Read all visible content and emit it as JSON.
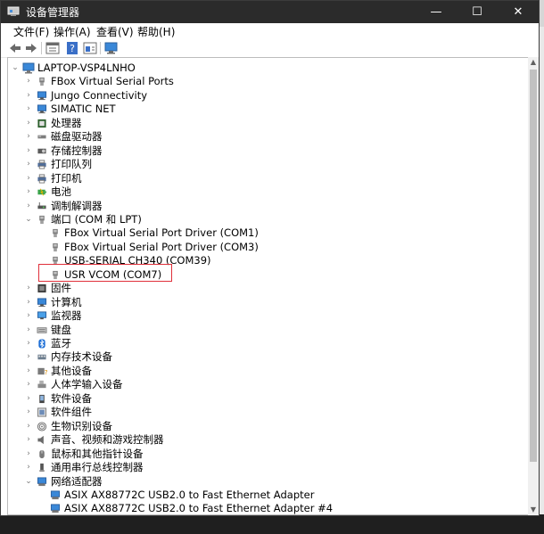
{
  "window": {
    "title": "设备管理器"
  },
  "window_controls": {
    "minimize": "—",
    "maximize": "☐",
    "close": "✕"
  },
  "menu": [
    "文件(F)",
    "操作(A)",
    "查看(V)",
    "帮助(H)"
  ],
  "toolbar": [
    "back-icon",
    "forward-icon",
    "properties-grid-icon",
    "help-icon",
    "view-icon",
    "monitor-scan-icon"
  ],
  "tree": {
    "root": {
      "label": "LAPTOP-VSP4LNHO",
      "expanded": true
    },
    "items": [
      {
        "label": "FBox Virtual Serial Ports",
        "level": 1,
        "icon": "port-icon",
        "expanded": false
      },
      {
        "label": "Jungo Connectivity",
        "level": 1,
        "icon": "network-device-icon",
        "expanded": false
      },
      {
        "label": "SIMATIC NET",
        "level": 1,
        "icon": "network-device-icon",
        "expanded": false
      },
      {
        "label": "处理器",
        "level": 1,
        "icon": "processor-icon",
        "expanded": false
      },
      {
        "label": "磁盘驱动器",
        "level": 1,
        "icon": "disk-drive-icon",
        "expanded": false
      },
      {
        "label": "存储控制器",
        "level": 1,
        "icon": "storage-controller-icon",
        "expanded": false
      },
      {
        "label": "打印队列",
        "level": 1,
        "icon": "printer-icon",
        "expanded": false
      },
      {
        "label": "打印机",
        "level": 1,
        "icon": "printer-icon",
        "expanded": false
      },
      {
        "label": "电池",
        "level": 1,
        "icon": "battery-icon",
        "expanded": false
      },
      {
        "label": "调制解调器",
        "level": 1,
        "icon": "modem-icon",
        "expanded": false
      },
      {
        "label": "端口 (COM 和 LPT)",
        "level": 1,
        "icon": "port-icon",
        "expanded": true
      },
      {
        "label": "FBox Virtual Serial Port Driver (COM1)",
        "level": 2,
        "icon": "port-icon"
      },
      {
        "label": "FBox Virtual Serial Port Driver (COM3)",
        "level": 2,
        "icon": "port-icon"
      },
      {
        "label": "USB-SERIAL CH340 (COM39)",
        "level": 2,
        "icon": "port-icon"
      },
      {
        "label": "USR VCOM (COM7)",
        "level": 2,
        "icon": "port-icon",
        "highlighted": true
      },
      {
        "label": "固件",
        "level": 1,
        "icon": "firmware-icon",
        "expanded": false
      },
      {
        "label": "计算机",
        "level": 1,
        "icon": "computer-icon",
        "expanded": false
      },
      {
        "label": "监视器",
        "level": 1,
        "icon": "monitor-icon",
        "expanded": false
      },
      {
        "label": "键盘",
        "level": 1,
        "icon": "keyboard-icon",
        "expanded": false
      },
      {
        "label": "蓝牙",
        "level": 1,
        "icon": "bluetooth-icon",
        "expanded": false
      },
      {
        "label": "内存技术设备",
        "level": 1,
        "icon": "memory-icon",
        "expanded": false
      },
      {
        "label": "其他设备",
        "level": 1,
        "icon": "other-device-icon",
        "expanded": false
      },
      {
        "label": "人体学输入设备",
        "level": 1,
        "icon": "hid-icon",
        "expanded": false
      },
      {
        "label": "软件设备",
        "level": 1,
        "icon": "software-device-icon",
        "expanded": false
      },
      {
        "label": "软件组件",
        "level": 1,
        "icon": "software-component-icon",
        "expanded": false
      },
      {
        "label": "生物识别设备",
        "level": 1,
        "icon": "biometric-icon",
        "expanded": false
      },
      {
        "label": "声音、视频和游戏控制器",
        "level": 1,
        "icon": "speaker-icon",
        "expanded": false
      },
      {
        "label": "鼠标和其他指针设备",
        "level": 1,
        "icon": "mouse-icon",
        "expanded": false
      },
      {
        "label": "通用串行总线控制器",
        "level": 1,
        "icon": "usb-icon",
        "expanded": false
      },
      {
        "label": "网络适配器",
        "level": 1,
        "icon": "network-adapter-icon",
        "expanded": true
      },
      {
        "label": "ASIX AX88772C USB2.0 to Fast Ethernet Adapter",
        "level": 2,
        "icon": "network-adapter-icon"
      },
      {
        "label": "ASIX AX88772C USB2.0 to Fast Ethernet Adapter #4",
        "level": 2,
        "icon": "network-adapter-icon"
      }
    ]
  },
  "colors": {
    "titlebar": "#2b2b2b",
    "highlight_box": "#e0303a",
    "accent": "#1e7ad6"
  }
}
